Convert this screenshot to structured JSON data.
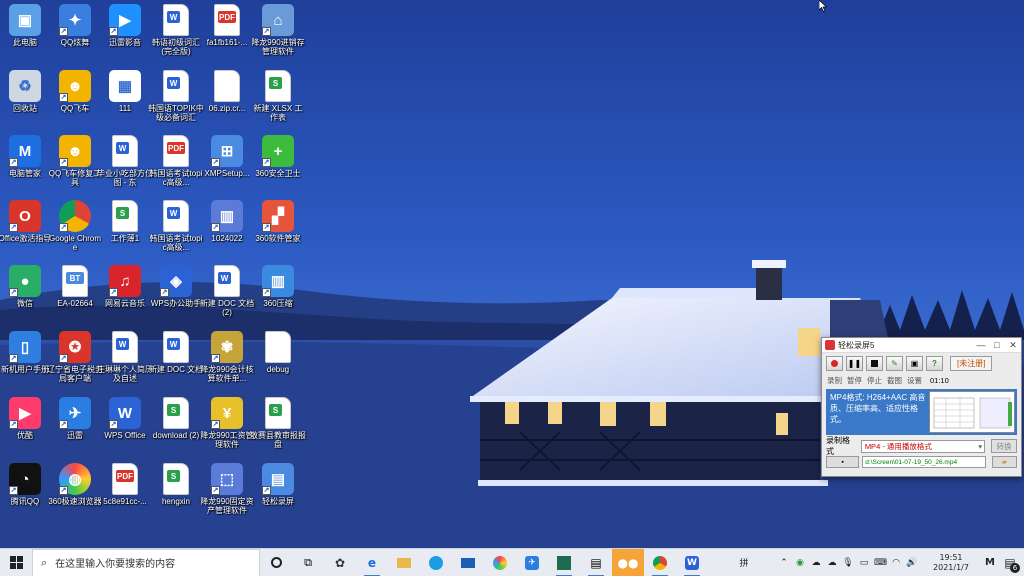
{
  "desktop": {
    "icons": [
      {
        "label": "此电脑"
      },
      {
        "label": "QQ炫舞"
      },
      {
        "label": "迅雷影音"
      },
      {
        "label": "韩语初级词汇(完全版)"
      },
      {
        "label": "fa1fb161-..."
      },
      {
        "label": "降龙990进销存管理软件"
      },
      {
        "label": "回收站"
      },
      {
        "label": "QQ飞车"
      },
      {
        "label": "111"
      },
      {
        "label": "韩国语TOPIK中级必备词汇"
      },
      {
        "label": "06.zip.cr..."
      },
      {
        "label": "新建 XLSX 工作表"
      },
      {
        "label": "电脑管家"
      },
      {
        "label": "QQ飞车修复工具"
      },
      {
        "label": "毕业小吃部方位图 - 东"
      },
      {
        "label": "韩国语考试topic高级..."
      },
      {
        "label": "XMPSetup..."
      },
      {
        "label": "360安全卫士"
      },
      {
        "label": "Office激活指导"
      },
      {
        "label": "Google Chrome"
      },
      {
        "label": "工作薄1"
      },
      {
        "label": "韩国语考试topic高级..."
      },
      {
        "label": "1024022"
      },
      {
        "label": "360软件管家"
      },
      {
        "label": "微信"
      },
      {
        "label": "EA-02664"
      },
      {
        "label": "网易云音乐"
      },
      {
        "label": "WPS办公助手"
      },
      {
        "label": "新建 DOC 文档 (2)"
      },
      {
        "label": "360压缩"
      },
      {
        "label": "新机用户手册"
      },
      {
        "label": "辽宁省电子税务局客户端"
      },
      {
        "label": "庄琳琳个人简历及自述"
      },
      {
        "label": "新建 DOC 文档"
      },
      {
        "label": "降龙990会计核算软件单..."
      },
      {
        "label": "debug"
      },
      {
        "label": "优酷"
      },
      {
        "label": "迅雷"
      },
      {
        "label": "WPS Office"
      },
      {
        "label": "download (2)"
      },
      {
        "label": "降龙990工资管理软件"
      },
      {
        "label": "敬赛县教审报报盘"
      },
      {
        "label": "腾讯QQ"
      },
      {
        "label": "360极速浏览器"
      },
      {
        "label": "5c8e91cc-..."
      },
      {
        "label": "hengxin"
      },
      {
        "label": "降龙990固定资产管理软件"
      },
      {
        "label": "轻松录屏"
      }
    ]
  },
  "recorder": {
    "title": "轻松录屏5",
    "register": "[未注册]",
    "labels": [
      "录制",
      "暂停",
      "停止",
      "截图",
      "设置"
    ],
    "time": "01:10",
    "info": "MP4格式: H264+AAC 高音质、压缩率高、适应性格式。",
    "format_label": "录制格式",
    "format_value": "MP4 - 通用播放格式",
    "convert": "转换",
    "path": "d:\\Screen\\01-07-19_50_26.mp4"
  },
  "taskbar": {
    "search_placeholder": "在这里输入你要搜索的内容",
    "time": "19:51",
    "date": "2021/1/7",
    "notifications": "6",
    "ime": "拼"
  },
  "colors": {
    "taskbar_bg": "#e8ecf2",
    "accent": "#3a7bd5",
    "active_app": "#f6a33a"
  }
}
